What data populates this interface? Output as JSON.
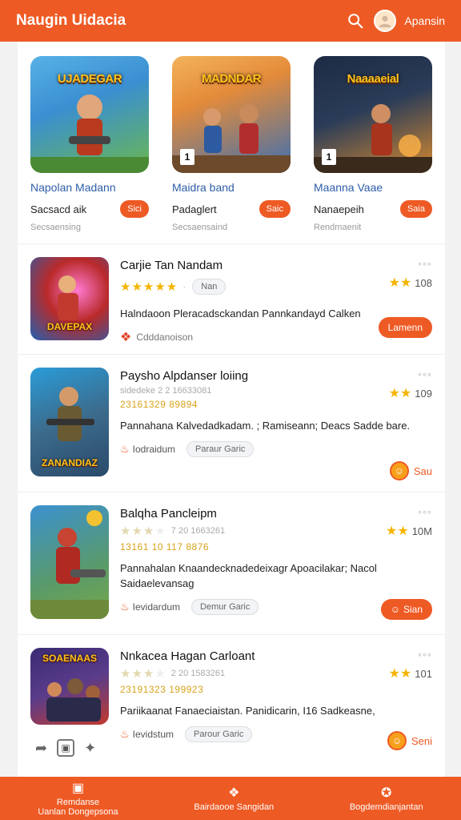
{
  "header": {
    "title": "Naugin Uidacia",
    "user_label": "Apansin",
    "search_icon": "search-icon",
    "avatar_icon": "user-avatar-icon"
  },
  "featured": [
    {
      "name": "Napolan Madann",
      "sub": "Sacsacd aik",
      "button": "Sici",
      "meta": "Secsaensing",
      "logo": "UJADEGAR",
      "badge": "",
      "colors": [
        "#3a8fd1",
        "#6bb84f"
      ]
    },
    {
      "name": "Maidra band",
      "sub": "Padaglert",
      "button": "Saic",
      "meta": "Secsaensaind",
      "logo": "MADNDAR",
      "badge": "1",
      "colors": [
        "#e48b3a",
        "#3a6fb3"
      ]
    },
    {
      "name": "Maanna Vaae",
      "sub": "Nanaepeih",
      "button": "Saia",
      "meta": "Rendmaenit",
      "logo": "Naaaaeial",
      "badge": "1",
      "colors": [
        "#2a3c58",
        "#d88a2f"
      ]
    }
  ],
  "items": [
    {
      "title": "Carjie Tan Nandam",
      "stars": "★★★★★",
      "stars_faded": "",
      "pill": "Nan",
      "code": "",
      "desc": "Halndaoon Pleracadsckandan Pannkandayd Calken",
      "footer_text": "Cdddanoison",
      "footer_tag": "",
      "rating": "108",
      "rating_stars": "★★",
      "action": "Lamenn",
      "action_type": "button",
      "logo": "DAVEPAX",
      "colors": [
        "#b92a2a",
        "#2360b0"
      ]
    },
    {
      "title": "Paysho Alpdanser loiing",
      "stars": "",
      "stars_faded": "",
      "pill": "",
      "meta_line": "sidedeke 2 2 16633081",
      "code": "23161329 89894",
      "desc": "Pannahana Kalvedadkadam. ; Ramiseann; Deacs Sadde bare.",
      "footer_text": "Iodraidum",
      "footer_tag": "Paraur Garic",
      "rating": "109",
      "rating_stars": "★★",
      "action": "Sau",
      "action_type": "coin",
      "logo": "ZANANDIAZ",
      "colors": [
        "#2a9cd8",
        "#2b4a6a"
      ]
    },
    {
      "title": "Balqha Pancleipm",
      "stars": "★★★",
      "stars_faded": "★",
      "pill": "",
      "meta_line": "7 20 1663261",
      "code": "13161 10 117 8876",
      "desc": "Pannahalan Knaandecknadedeixagr Apoacilakar; Nacol Saidaelevansag",
      "footer_text": "Ievidardum",
      "footer_tag": "Demur Garic",
      "rating": "10M",
      "rating_stars": "★★",
      "action": "Sian",
      "action_type": "pill-coin",
      "logo": "",
      "colors": [
        "#3b91cf",
        "#76a84a"
      ]
    },
    {
      "title": "Nnkacea Hagan Carloant",
      "stars": "★★★",
      "stars_faded": "★",
      "pill": "",
      "meta_line": "2 20 1583261",
      "code": "23191323 199923",
      "desc": "Pariikaanat Fanaeciaistan. Panidicarin, I16 Sadkeasne,",
      "footer_text": "Ievidstum",
      "footer_tag": "Parour Garic",
      "rating": "101",
      "rating_stars": "★★",
      "action": "Seni",
      "action_type": "coin",
      "logo": "SOAENAAS",
      "colors": [
        "#3a2b74",
        "#c23a2e"
      ]
    }
  ],
  "social": [
    "share-icon",
    "bookmark-icon",
    "twitter-icon"
  ],
  "bottom_nav": [
    {
      "icon": "calendar-icon",
      "line1": "Remdanse",
      "line2": "Uanlan Dongepsona"
    },
    {
      "icon": "apps-icon",
      "line1": "",
      "line2": "Bairdaooe Sangidan"
    },
    {
      "icon": "trophy-icon",
      "line1": "",
      "line2": "Bogdemdianjantan"
    }
  ],
  "colors": {
    "accent": "#ee5a24",
    "star": "#f5b400",
    "link": "#2e5ea8"
  }
}
